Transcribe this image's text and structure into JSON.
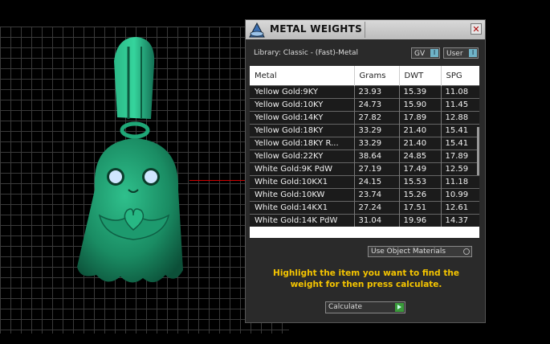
{
  "panel": {
    "title": "METAL WEIGHTS",
    "close_glyph": "✕",
    "library_label": "Library: Classic - (Fast)-Metal",
    "gv_label": "GV",
    "user_label": "User",
    "toggle_glyph": "I",
    "columns": [
      "Metal",
      "Grams",
      "DWT",
      "SPG"
    ],
    "rows": [
      [
        "Yellow Gold:9KY",
        "23.93",
        "15.39",
        "11.08"
      ],
      [
        "Yellow Gold:10KY",
        "24.73",
        "15.90",
        "11.45"
      ],
      [
        "Yellow Gold:14KY",
        "27.82",
        "17.89",
        "12.88"
      ],
      [
        "Yellow Gold:18KY",
        "33.29",
        "21.40",
        "15.41"
      ],
      [
        "Yellow Gold:18KY R...",
        "33.29",
        "21.40",
        "15.41"
      ],
      [
        "Yellow Gold:22KY",
        "38.64",
        "24.85",
        "17.89"
      ],
      [
        "White Gold:9K PdW",
        "27.19",
        "17.49",
        "12.59"
      ],
      [
        "White Gold:10KX1",
        "24.15",
        "15.53",
        "11.18"
      ],
      [
        "White Gold:10KW",
        "23.74",
        "15.26",
        "10.99"
      ],
      [
        "White Gold:14KX1",
        "27.24",
        "17.51",
        "12.61"
      ],
      [
        "White Gold:14K PdW",
        "31.04",
        "19.96",
        "14.37"
      ]
    ],
    "use_object_materials": "Use Object Materials",
    "instruction": "Highlight the item you want to find the weight for then press calculate.",
    "calculate_label": "Calculate"
  },
  "colors": {
    "instruction": "#f4c400",
    "model": "#1f9e72",
    "eyes": "#cfe6ff"
  }
}
